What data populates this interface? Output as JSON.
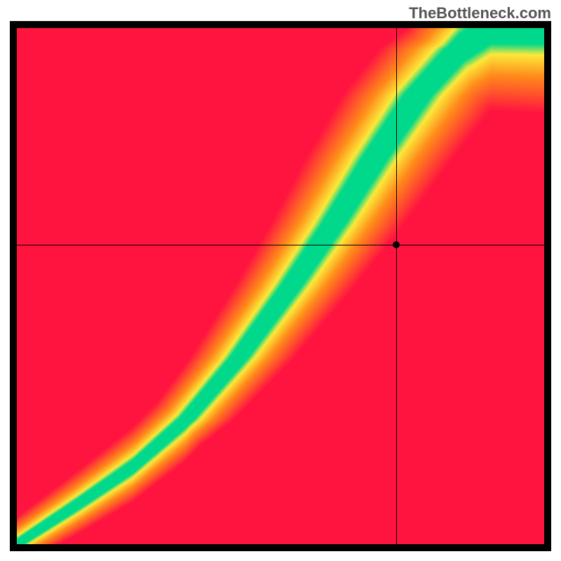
{
  "watermark": "TheBottleneck.com",
  "chart_data": {
    "type": "heatmap",
    "title": "",
    "xlabel": "",
    "ylabel": "",
    "xlim": [
      0,
      100
    ],
    "ylim": [
      0,
      100
    ],
    "grid": false,
    "legend": false,
    "marker": {
      "x": 72,
      "y": 58
    },
    "crosshair": {
      "x": 72,
      "y": 58
    },
    "optimal_curve": [
      {
        "x": 0,
        "y": 0
      },
      {
        "x": 12,
        "y": 8
      },
      {
        "x": 22,
        "y": 15
      },
      {
        "x": 32,
        "y": 24
      },
      {
        "x": 42,
        "y": 36
      },
      {
        "x": 52,
        "y": 50
      },
      {
        "x": 60,
        "y": 62
      },
      {
        "x": 68,
        "y": 75
      },
      {
        "x": 76,
        "y": 87
      },
      {
        "x": 84,
        "y": 96
      },
      {
        "x": 90,
        "y": 100
      }
    ],
    "gradient_colors": {
      "good": "#00D98B",
      "mid": "#FCE93A",
      "warn": "#FF8C1A",
      "bad": "#FF1440"
    },
    "band_thickness_frac": 0.055,
    "description": "2D heatmap showing goodness (green) along an optimal curve from lower-left to upper-right; regions far from the curve fade through yellow/orange to red. A black crosshair and dot mark a reference point."
  }
}
